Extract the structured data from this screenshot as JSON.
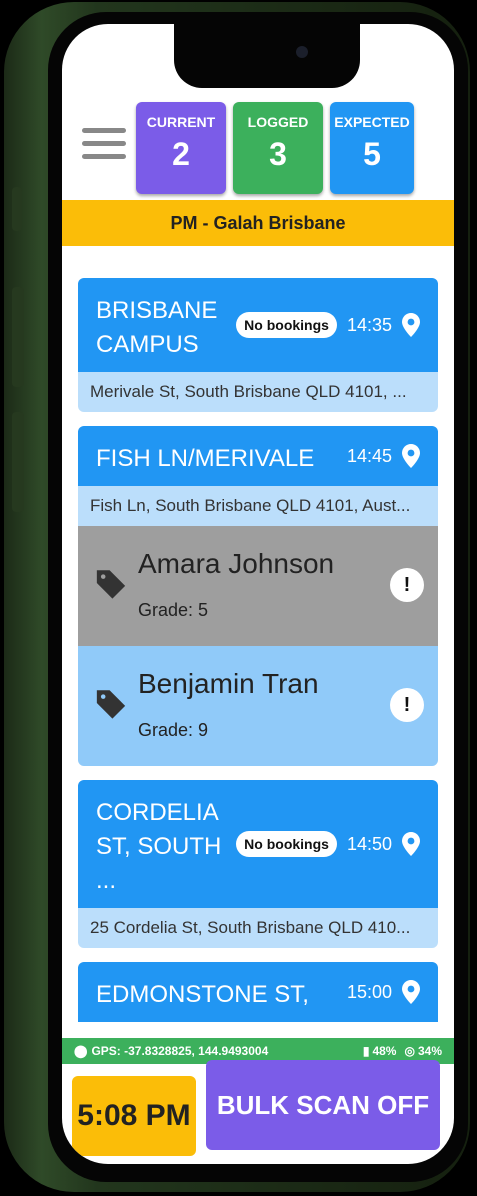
{
  "header": {
    "counters": [
      {
        "label": "CURRENT",
        "value": "2"
      },
      {
        "label": "LOGGED",
        "value": "3"
      },
      {
        "label": "EXPECTED",
        "value": "5"
      }
    ],
    "route": "PM - Galah Brisbane"
  },
  "stops": [
    {
      "name": "BRISBANE CAMPUS",
      "badge": "No bookings",
      "time": "14:35",
      "address": "Merivale St, South Brisbane QLD 4101, ..."
    },
    {
      "name": "FISH LN/MERIVALE",
      "badge": "",
      "time": "14:45",
      "address": "Fish Ln, South Brisbane QLD 4101, Aust...",
      "students": [
        {
          "name": "Amara Johnson",
          "grade": "Grade: 5"
        },
        {
          "name": "Benjamin Tran",
          "grade": "Grade: 9"
        }
      ]
    },
    {
      "name": "CORDELIA ST, SOUTH ...",
      "badge": "No bookings",
      "time": "14:50",
      "address": "25 Cordelia St, South Brisbane QLD 410..."
    },
    {
      "name": "EDMONSTONE ST,",
      "badge": "",
      "time": "15:00",
      "address": ""
    }
  ],
  "status_bar": {
    "gps": "GPS: -37.8328825, 144.9493004",
    "battery": "48%",
    "signal": "34%"
  },
  "footer": {
    "clock": "5:08 PM",
    "bulk_scan": "BULK SCAN OFF"
  },
  "icons": [
    "menu-icon",
    "location-pin-icon",
    "tag-icon",
    "alert-icon",
    "battery-icon",
    "signal-icon"
  ],
  "colors": {
    "purple": "#7b5ce8",
    "green": "#3cb05c",
    "blue": "#2196f3",
    "yellow": "#fbbd08"
  }
}
